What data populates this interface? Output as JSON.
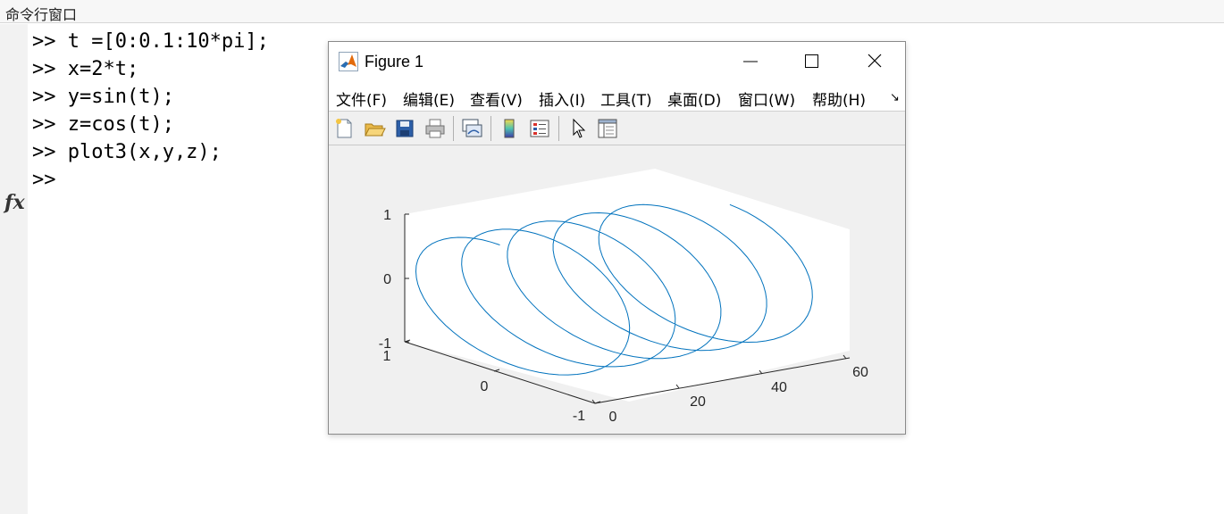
{
  "command_window": {
    "title": "命令行窗口",
    "fx_label": "fx",
    "lines": [
      ">> t =[0:0.1:10*pi];",
      ">> x=2*t;",
      ">> y=sin(t);",
      ">> z=cos(t);",
      ">> plot3(x,y,z);",
      ">>"
    ]
  },
  "figure": {
    "title": "Figure 1",
    "menus": [
      "文件(F)",
      "编辑(E)",
      "查看(V)",
      "插入(I)",
      "工具(T)",
      "桌面(D)",
      "窗口(W)",
      "帮助(H)"
    ],
    "menu_more": "↘",
    "toolbar_icons": [
      "new-figure-icon",
      "open-file-icon",
      "save-icon",
      "print-icon",
      "link-plot-icon",
      "colorbar-icon",
      "legend-icon",
      "pointer-icon",
      "property-editor-icon"
    ]
  },
  "chart_data": {
    "type": "line",
    "title": "",
    "xlabel": "",
    "ylabel": "",
    "zlabel": "",
    "x_expr": "x=2*t",
    "y_expr": "y=sin(t)",
    "z_expr": "z=cos(t)",
    "t_range": [
      0,
      0.1,
      31.4
    ],
    "xlim": [
      0,
      70
    ],
    "ylim": [
      -1,
      1
    ],
    "zlim": [
      -1,
      1
    ],
    "x_ticks": [
      "0",
      "20",
      "40",
      "60"
    ],
    "y_ticks": [
      "-1",
      "0",
      "1"
    ],
    "z_ticks": [
      "-1",
      "0",
      "1"
    ],
    "line_color": "#0072bd",
    "grid": false
  },
  "colors": {
    "accent": "#0072bd",
    "plot_background": "#f0f0f0",
    "axes_background": "#ffffff"
  }
}
